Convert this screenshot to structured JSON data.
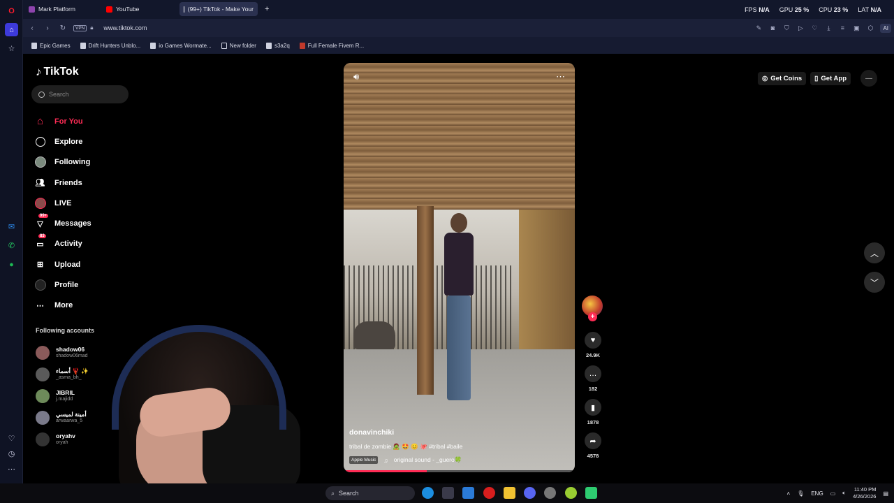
{
  "browser": {
    "tabs": [
      {
        "label": "Mark Platform",
        "color": "#8e44ad"
      },
      {
        "label": "YouTube",
        "color": "#ff0000"
      },
      {
        "label": "(99+) TikTok - Make Your",
        "color": "#ffffff"
      }
    ],
    "new_tab_icon": "plus-icon",
    "stats": {
      "fps_label": "FPS",
      "fps_value": "N/A",
      "gpu_label": "GPU",
      "gpu_value": "25 %",
      "cpu_label": "CPU",
      "cpu_value": "23 %",
      "lat_label": "LAT",
      "lat_value": "N/A"
    },
    "vpn_label": "VPN",
    "url": "www.tiktok.com",
    "ai_label": "AI",
    "bookmarks": [
      "Epic Games",
      "Drift Hunters Unblo...",
      "io Games Wormate...",
      "New folder",
      "s3a2q",
      "Full Female Fivem R..."
    ]
  },
  "tiktok": {
    "logo": "TikTok",
    "search_placeholder": "Search",
    "nav": [
      {
        "label": "For You",
        "icon": "home-icon",
        "active": true
      },
      {
        "label": "Explore",
        "icon": "compass-icon"
      },
      {
        "label": "Following",
        "icon": "following-avatar-icon"
      },
      {
        "label": "Friends",
        "icon": "friends-icon"
      },
      {
        "label": "LIVE",
        "icon": "live-icon"
      },
      {
        "label": "Messages",
        "icon": "messages-icon",
        "badge": "99+"
      },
      {
        "label": "Activity",
        "icon": "activity-icon",
        "badge": "83"
      },
      {
        "label": "Upload",
        "icon": "upload-icon"
      },
      {
        "label": "Profile",
        "icon": "profile-icon"
      },
      {
        "label": "More",
        "icon": "more-icon"
      }
    ],
    "following_heading": "Following accounts",
    "following": [
      {
        "name": "shadow06",
        "handle": "shadow06mad"
      },
      {
        "name": "أسماء 🦞 ✨",
        "handle": "_asma_bh_"
      },
      {
        "name": "JIBRIL",
        "handle": "j.majidd"
      },
      {
        "name": "أمينة لميسي",
        "handle": "arwaarwa_5"
      },
      {
        "name": "oryahv",
        "handle": "oryah"
      }
    ],
    "video": {
      "username": "donavinchiki",
      "caption": "tribal de zombie 🧟 🤩 😊 🐙 #tribal #baile",
      "apple_music_label": "Apple Music",
      "sound": "original sound - _guero🍀",
      "progress": 0.36
    },
    "actions": {
      "likes": "24.9K",
      "comments": "182",
      "saves": "1878",
      "shares": "4578"
    },
    "top_right": {
      "get_coins": "Get Coins",
      "get_app": "Get App"
    },
    "accent_color": "#fe2c55"
  },
  "taskbar": {
    "search_label": "Search",
    "language": "ENG",
    "time": "11:40 PM",
    "date": "4/26/2026"
  }
}
